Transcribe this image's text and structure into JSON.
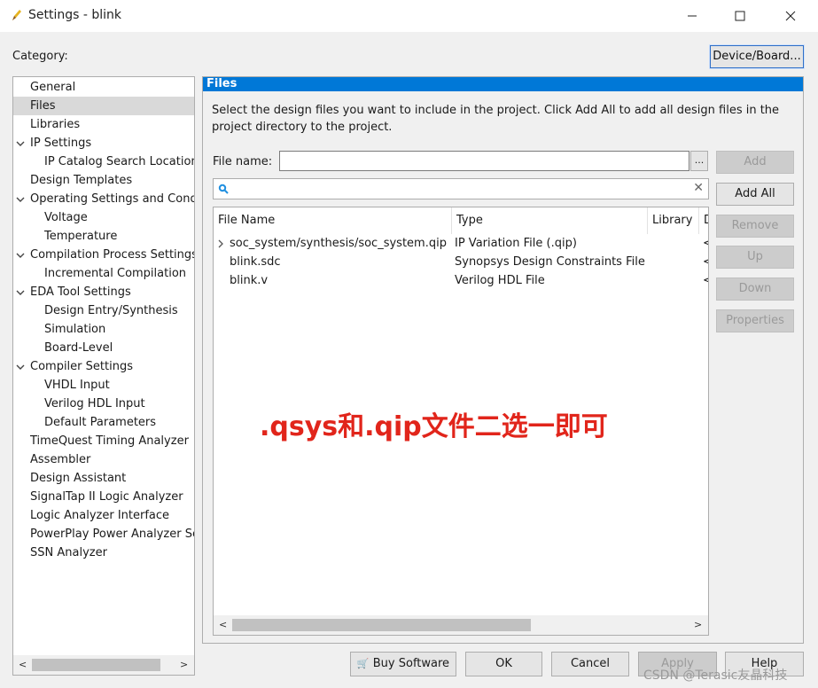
{
  "window": {
    "title": "Settings - blink",
    "minimize_glyph": "—",
    "maximize_glyph": "☐",
    "close_glyph": "✕"
  },
  "category_label": "Category:",
  "device_board_label": "Device/Board...",
  "category_tree": [
    {
      "label": "General",
      "level": 0,
      "expandable": false,
      "selected": false
    },
    {
      "label": "Files",
      "level": 0,
      "expandable": false,
      "selected": true
    },
    {
      "label": "Libraries",
      "level": 0,
      "expandable": false,
      "selected": false
    },
    {
      "label": "IP Settings",
      "level": 0,
      "expandable": true,
      "selected": false
    },
    {
      "label": "IP Catalog Search Locations",
      "level": 1,
      "expandable": false,
      "selected": false
    },
    {
      "label": "Design Templates",
      "level": 0,
      "expandable": false,
      "selected": false
    },
    {
      "label": "Operating Settings and Conditions",
      "level": 0,
      "expandable": true,
      "selected": false
    },
    {
      "label": "Voltage",
      "level": 1,
      "expandable": false,
      "selected": false
    },
    {
      "label": "Temperature",
      "level": 1,
      "expandable": false,
      "selected": false
    },
    {
      "label": "Compilation Process Settings",
      "level": 0,
      "expandable": true,
      "selected": false
    },
    {
      "label": "Incremental Compilation",
      "level": 1,
      "expandable": false,
      "selected": false
    },
    {
      "label": "EDA Tool Settings",
      "level": 0,
      "expandable": true,
      "selected": false
    },
    {
      "label": "Design Entry/Synthesis",
      "level": 1,
      "expandable": false,
      "selected": false
    },
    {
      "label": "Simulation",
      "level": 1,
      "expandable": false,
      "selected": false
    },
    {
      "label": "Board-Level",
      "level": 1,
      "expandable": false,
      "selected": false
    },
    {
      "label": "Compiler Settings",
      "level": 0,
      "expandable": true,
      "selected": false
    },
    {
      "label": "VHDL Input",
      "level": 1,
      "expandable": false,
      "selected": false
    },
    {
      "label": "Verilog HDL Input",
      "level": 1,
      "expandable": false,
      "selected": false
    },
    {
      "label": "Default Parameters",
      "level": 1,
      "expandable": false,
      "selected": false
    },
    {
      "label": "TimeQuest Timing Analyzer",
      "level": 0,
      "expandable": false,
      "selected": false
    },
    {
      "label": "Assembler",
      "level": 0,
      "expandable": false,
      "selected": false
    },
    {
      "label": "Design Assistant",
      "level": 0,
      "expandable": false,
      "selected": false
    },
    {
      "label": "SignalTap II Logic Analyzer",
      "level": 0,
      "expandable": false,
      "selected": false
    },
    {
      "label": "Logic Analyzer Interface",
      "level": 0,
      "expandable": false,
      "selected": false
    },
    {
      "label": "PowerPlay Power Analyzer Settings",
      "level": 0,
      "expandable": false,
      "selected": false
    },
    {
      "label": "SSN Analyzer",
      "level": 0,
      "expandable": false,
      "selected": false
    }
  ],
  "files_panel": {
    "header": "Files",
    "description": "Select the design files you want to include in the project. Click Add All to add all design files in the project directory to the project.",
    "file_name_label": "File name:",
    "file_name_value": "",
    "browse_label": "...",
    "search_value": "",
    "columns": [
      "File Name",
      "Type",
      "Library",
      "Design Entry/Synthesis Tool"
    ],
    "rows": [
      {
        "name": "soc_system/synthesis/soc_system.qip",
        "type": "IP Variation File (.qip)",
        "library": "",
        "tool": "<None>",
        "expandable": true
      },
      {
        "name": "blink.sdc",
        "type": "Synopsys Design Constraints File",
        "library": "",
        "tool": "<None>",
        "expandable": false
      },
      {
        "name": "blink.v",
        "type": "Verilog HDL File",
        "library": "",
        "tool": "<None>",
        "expandable": false
      }
    ],
    "buttons": {
      "add": "Add",
      "add_all": "Add All",
      "remove": "Remove",
      "up": "Up",
      "down": "Down",
      "properties": "Properties"
    }
  },
  "annotation": ".qsys和.qip文件二选一即可",
  "bottom_buttons": {
    "buy_software": "Buy Software",
    "ok": "OK",
    "cancel": "Cancel",
    "apply": "Apply",
    "help": "Help"
  },
  "watermark": "CSDN @Terasic友晶科技",
  "colors": {
    "accent": "#0078d7",
    "annotation": "#e1251b",
    "selected_row": "#d9d9d9"
  }
}
